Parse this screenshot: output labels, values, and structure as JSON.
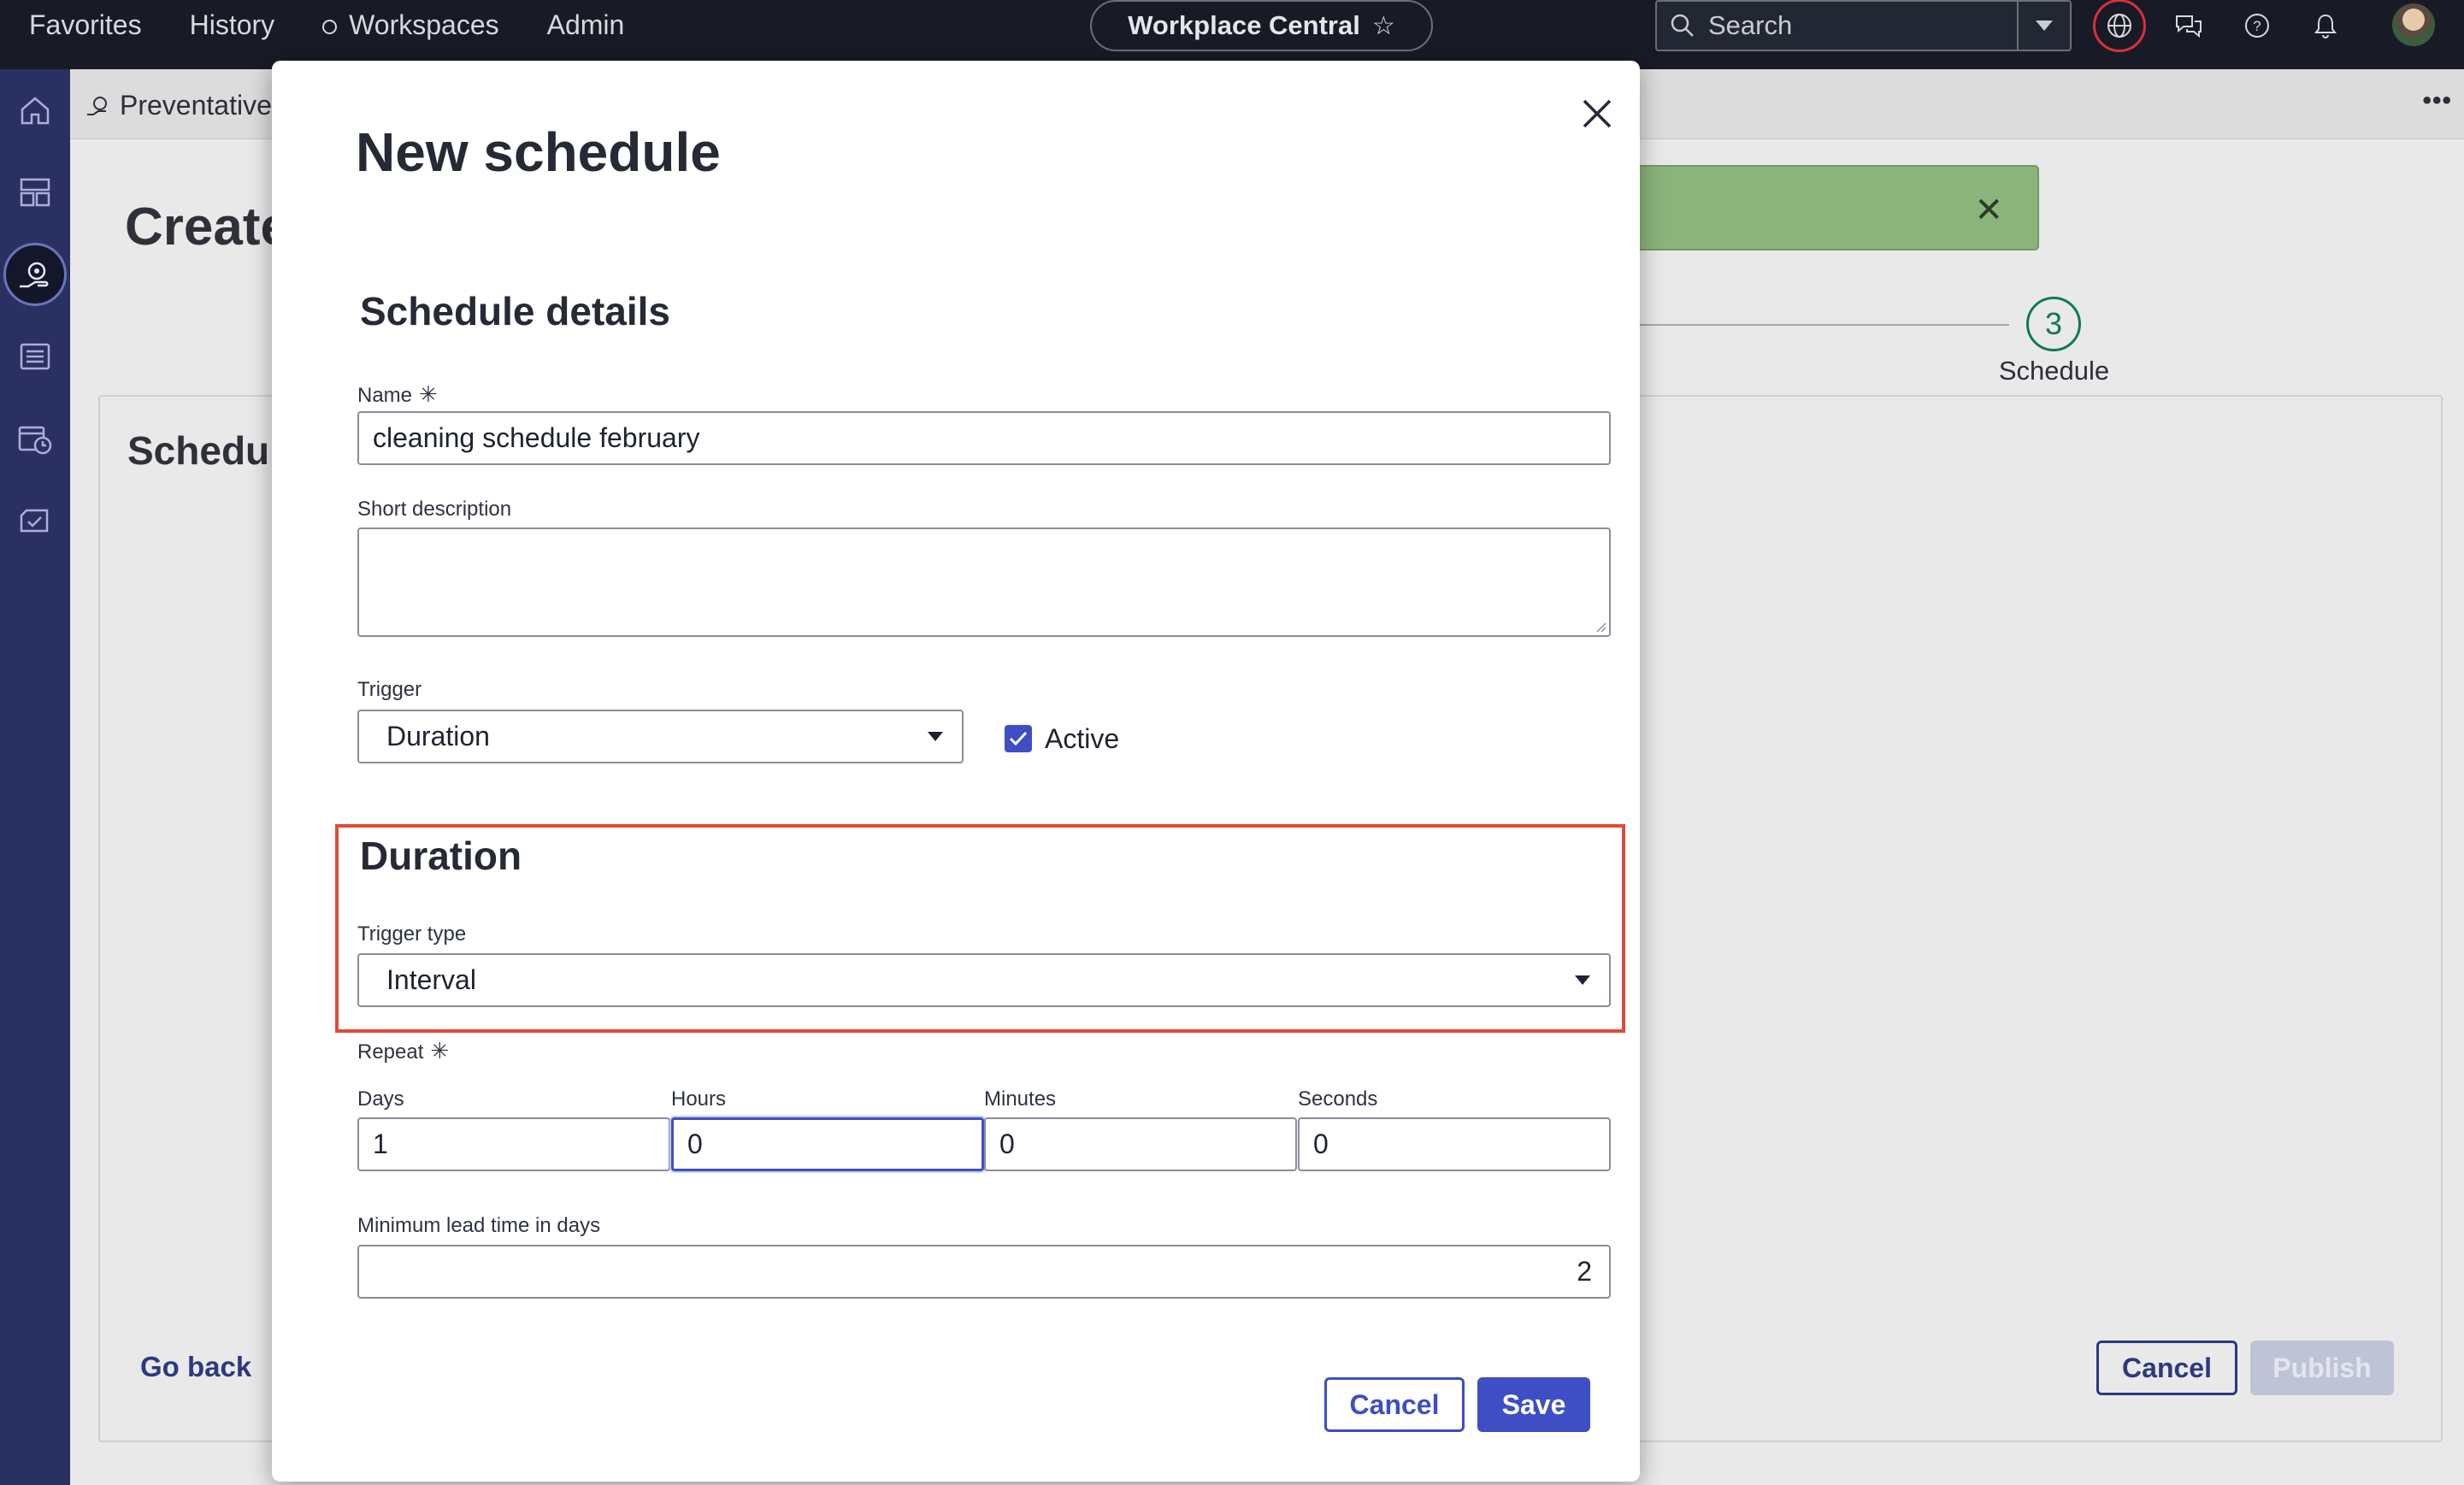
{
  "topbar": {
    "nav": [
      "Favorites",
      "History",
      "Workspaces",
      "Admin"
    ],
    "app_name": "Workplace Central",
    "search_placeholder": "Search"
  },
  "breadcrumb": "Preventative",
  "background": {
    "page_title": "Create",
    "card_title": "Schedule",
    "step_number": "3",
    "step_label": "Schedule",
    "go_back": "Go back",
    "cancel": "Cancel",
    "publish": "Publish"
  },
  "modal": {
    "title": "New schedule",
    "details_heading": "Schedule details",
    "name_label": "Name",
    "name_value": "cleaning schedule february",
    "required_mark": "✳",
    "short_desc_label": "Short description",
    "short_desc_value": "",
    "trigger_label": "Trigger",
    "trigger_value": "Duration",
    "active_label": "Active",
    "active_checked": true,
    "duration_heading": "Duration",
    "trigger_type_label": "Trigger type",
    "trigger_type_value": "Interval",
    "repeat_label": "Repeat",
    "days_label": "Days",
    "days_value": "1",
    "hours_label": "Hours",
    "hours_value": "0",
    "minutes_label": "Minutes",
    "minutes_value": "0",
    "seconds_label": "Seconds",
    "seconds_value": "0",
    "lead_time_label": "Minimum lead time in days",
    "lead_time_value": "2",
    "cancel_label": "Cancel",
    "save_label": "Save"
  },
  "colors": {
    "accent": "#3e4ec4",
    "highlight": "#e14b35",
    "rail": "#2a3162",
    "topbar": "#181b25"
  }
}
